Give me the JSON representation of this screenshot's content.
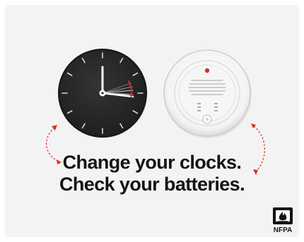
{
  "poster": {
    "background_color": "#f4f3f3",
    "headline_line1": "Change your clocks.",
    "headline_line2": "Check your batteries.",
    "text_color": "#141414",
    "accent_color": "#d8322b"
  },
  "clock": {
    "face_color": "#2b2b2b",
    "hand_color": "#ffffff"
  },
  "smoke_alarm": {
    "body_color": "#ffffff",
    "indicator_color": "#d8322b"
  },
  "logo": {
    "text": "NFPA",
    "icon": "nfpa-flame-logo-icon"
  }
}
